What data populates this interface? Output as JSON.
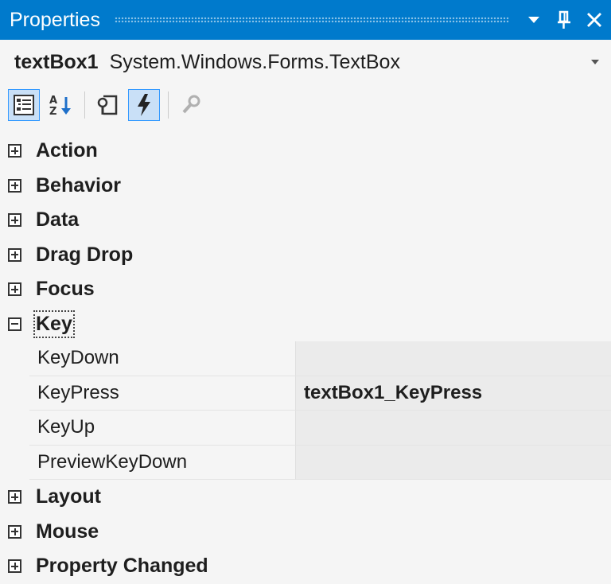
{
  "window": {
    "title": "Properties",
    "buttons": [
      "dropdown-icon",
      "pin-icon",
      "close-icon"
    ]
  },
  "object_selector": {
    "name": "textBox1",
    "type": "System.Windows.Forms.TextBox"
  },
  "toolbar": {
    "buttons": [
      {
        "icon": "categorized-icon",
        "active": true
      },
      {
        "icon": "alphabetical-icon",
        "active": false
      },
      {
        "icon": "properties-icon",
        "active": false
      },
      {
        "icon": "events-lightning-icon",
        "active": true
      },
      {
        "icon": "property-pages-icon",
        "active": false
      }
    ]
  },
  "grid": {
    "categories": [
      {
        "label": "Action",
        "expanded": false
      },
      {
        "label": "Behavior",
        "expanded": false
      },
      {
        "label": "Data",
        "expanded": false
      },
      {
        "label": "Drag Drop",
        "expanded": false
      },
      {
        "label": "Focus",
        "expanded": false
      },
      {
        "label": "Key",
        "expanded": true,
        "focused": true,
        "properties": [
          {
            "name": "KeyDown",
            "value": ""
          },
          {
            "name": "KeyPress",
            "value": "textBox1_KeyPress"
          },
          {
            "name": "KeyUp",
            "value": ""
          },
          {
            "name": "PreviewKeyDown",
            "value": ""
          }
        ]
      },
      {
        "label": "Layout",
        "expanded": false
      },
      {
        "label": "Mouse",
        "expanded": false
      },
      {
        "label": "Property Changed",
        "expanded": false
      }
    ]
  },
  "colors": {
    "titlebar": "#007acc",
    "background": "#f5f5f5",
    "value_cell": "#ebebeb",
    "active_button": "#c9e0f7",
    "active_border": "#3399ff"
  }
}
